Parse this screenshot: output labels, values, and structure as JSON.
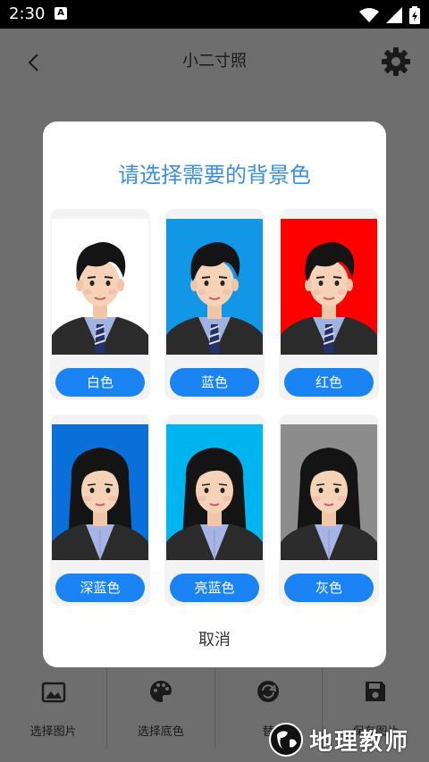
{
  "status": {
    "time": "2:30",
    "a_badge": "A"
  },
  "app_bar": {
    "title": "小二寸照"
  },
  "toolbar": {
    "items": [
      {
        "label": "选择图片",
        "icon": "image-icon"
      },
      {
        "label": "选择底色",
        "icon": "palette-icon"
      },
      {
        "label": "替",
        "icon": "replace-icon"
      },
      {
        "label": "保存图片",
        "icon": "save-icon"
      }
    ]
  },
  "dialog": {
    "title": "请选择需要的背景色",
    "options": [
      {
        "label": "白色",
        "color": "#ffffff"
      },
      {
        "label": "蓝色",
        "color": "#1296e6"
      },
      {
        "label": "红色",
        "color": "#ff0000"
      },
      {
        "label": "深蓝色",
        "color": "#0a6fd8"
      },
      {
        "label": "亮蓝色",
        "color": "#00b4f0"
      },
      {
        "label": "灰色",
        "color": "#8c8c8c"
      }
    ],
    "cancel_label": "取消"
  },
  "watermark": {
    "text": "地理教师"
  },
  "colors": {
    "accent": "#3a8fe0",
    "button": "#1a84f5",
    "scrim": "#6e6e6e"
  }
}
